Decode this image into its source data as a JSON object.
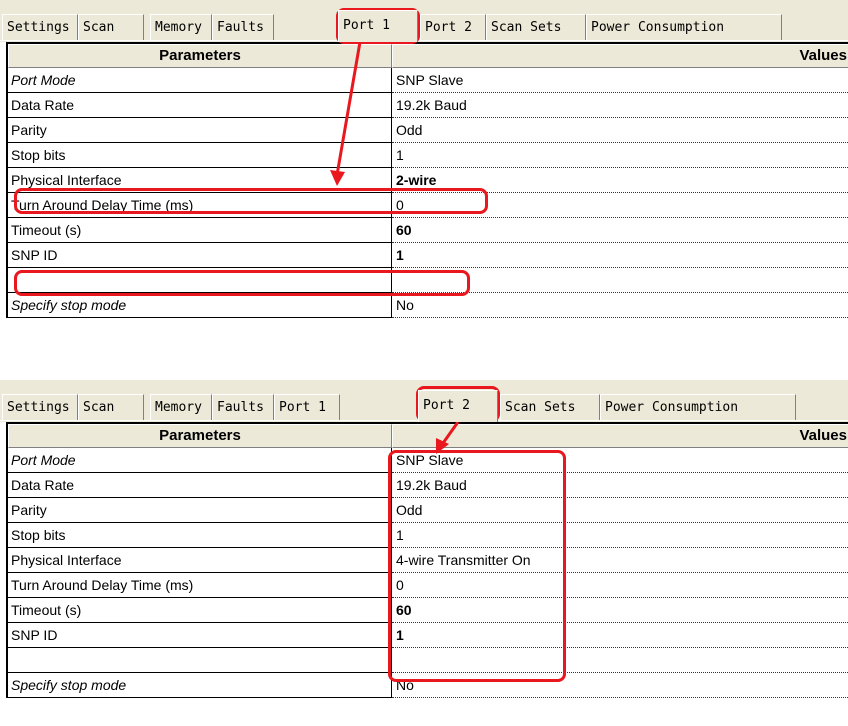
{
  "tabs": [
    "Settings",
    "Scan",
    "Memory",
    "Faults",
    "Port 1",
    "Port 2",
    "Scan Sets",
    "Power Consumption"
  ],
  "table_headers": {
    "parameters": "Parameters",
    "values": "Values"
  },
  "panel1": {
    "active_tab": "Port 1",
    "rows": [
      {
        "param": "Port Mode",
        "value": "SNP Slave"
      },
      {
        "param": "Data Rate",
        "value": "19.2k Baud"
      },
      {
        "param": "Parity",
        "value": "Odd"
      },
      {
        "param": "Stop bits",
        "value": "1"
      },
      {
        "param": "Physical Interface",
        "value": "2-wire"
      },
      {
        "param": "Turn Around Delay Time (ms)",
        "value": "0"
      },
      {
        "param": "Timeout (s)",
        "value": "60"
      },
      {
        "param": "SNP ID",
        "value": "1"
      },
      {
        "param": "",
        "value": ""
      },
      {
        "param": "Specify stop mode",
        "value": "No"
      }
    ]
  },
  "panel2": {
    "active_tab": "Port 2",
    "rows": [
      {
        "param": "Port Mode",
        "value": "SNP Slave"
      },
      {
        "param": "Data Rate",
        "value": "19.2k Baud"
      },
      {
        "param": "Parity",
        "value": "Odd"
      },
      {
        "param": "Stop bits",
        "value": "1"
      },
      {
        "param": "Physical Interface",
        "value": "4-wire Transmitter On"
      },
      {
        "param": "Turn Around Delay Time (ms)",
        "value": "0"
      },
      {
        "param": "Timeout (s)",
        "value": "60"
      },
      {
        "param": "SNP ID",
        "value": "1"
      },
      {
        "param": "",
        "value": ""
      },
      {
        "param": "Specify stop mode",
        "value": "No"
      }
    ]
  },
  "colors": {
    "highlight": "#e8181e",
    "tab_bg": "#ece9d8"
  }
}
